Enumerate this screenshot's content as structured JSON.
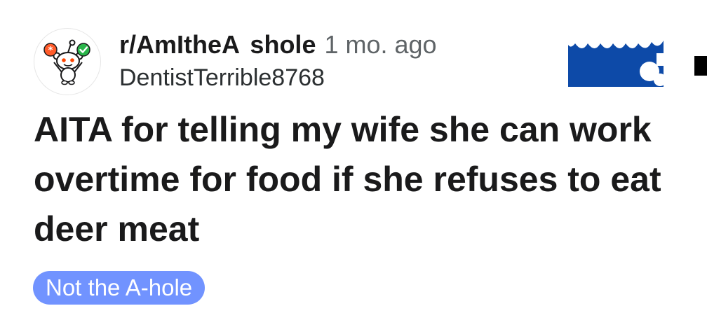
{
  "post": {
    "subreddit": "r/AmItheA  shole",
    "timestamp": "1 mo. ago",
    "username": "DentistTerrible8768",
    "title": "AITA for telling my wife she can work overtime for food if she refuses to eat deer meat",
    "flair": "Not the A-hole"
  },
  "colors": {
    "flair_background": "#7193ff",
    "thumbnail_blue": "#0d4aa8",
    "meta_gray": "#5f6467",
    "text_dark": "#1a1a1b"
  },
  "icons": {
    "avatar": "snoo-mascot-icon",
    "left_badge": "asterisk-badge-icon",
    "right_badge": "checkmark-badge-icon"
  }
}
